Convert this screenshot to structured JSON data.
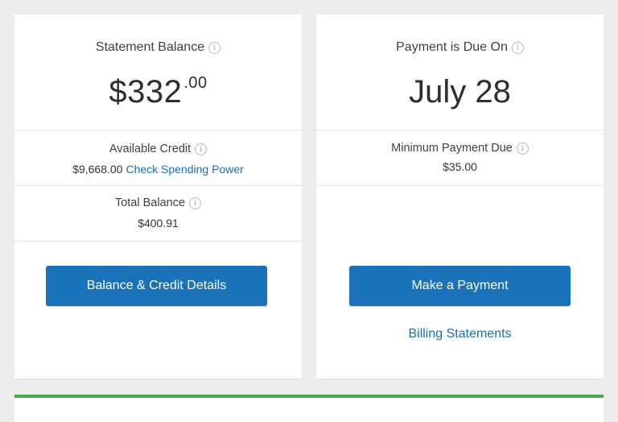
{
  "statement": {
    "label": "Statement Balance",
    "dollars": "$332",
    "cents": ".00",
    "available_credit_label": "Available Credit",
    "available_credit_value": "$9,668.00",
    "spending_power_link": "Check Spending Power",
    "total_balance_label": "Total Balance",
    "total_balance_value": "$400.91",
    "details_button": "Balance & Credit Details"
  },
  "payment": {
    "label": "Payment is Due On",
    "due_date": "July 28",
    "minimum_label": "Minimum Payment Due",
    "minimum_value": "$35.00",
    "pay_button": "Make a Payment",
    "statements_link": "Billing Statements"
  },
  "icons": {
    "info": "info-icon"
  },
  "colors": {
    "primary_button": "#1a73b8",
    "link": "#1a6fb0",
    "accent_bar": "#4caa4e",
    "background": "#ececec"
  }
}
